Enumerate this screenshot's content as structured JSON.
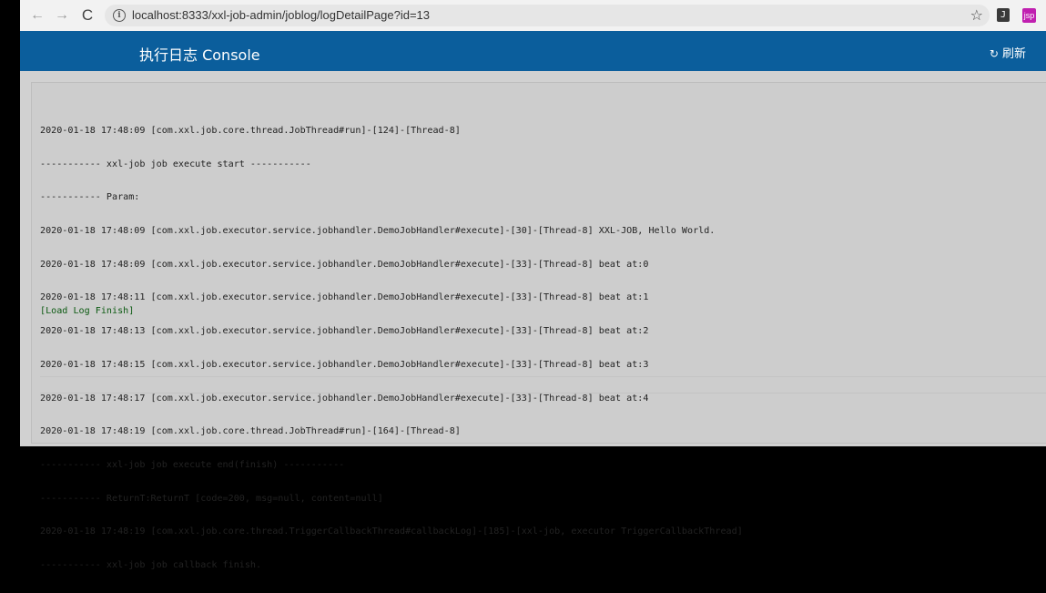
{
  "browser": {
    "url": "localhost:8333/xxl-job-admin/joblog/logDetailPage?id=13",
    "back_glyph": "←",
    "forward_glyph": "→",
    "reload_glyph": "C",
    "info_glyph": "i",
    "star_glyph": "☆",
    "ext_j_label": "J",
    "ext_p_label": "jsp"
  },
  "header": {
    "title": "执行日志 Console",
    "refresh_glyph": "↻",
    "refresh_label": "刷新",
    "background": "#0b5e9c"
  },
  "log": {
    "lines": [
      "2020-01-18 17:48:09 [com.xxl.job.core.thread.JobThread#run]-[124]-[Thread-8]",
      "----------- xxl-job job execute start -----------",
      "----------- Param:",
      "2020-01-18 17:48:09 [com.xxl.job.executor.service.jobhandler.DemoJobHandler#execute]-[30]-[Thread-8] XXL-JOB, Hello World.",
      "2020-01-18 17:48:09 [com.xxl.job.executor.service.jobhandler.DemoJobHandler#execute]-[33]-[Thread-8] beat at:0",
      "2020-01-18 17:48:11 [com.xxl.job.executor.service.jobhandler.DemoJobHandler#execute]-[33]-[Thread-8] beat at:1",
      "2020-01-18 17:48:13 [com.xxl.job.executor.service.jobhandler.DemoJobHandler#execute]-[33]-[Thread-8] beat at:2",
      "2020-01-18 17:48:15 [com.xxl.job.executor.service.jobhandler.DemoJobHandler#execute]-[33]-[Thread-8] beat at:3",
      "2020-01-18 17:48:17 [com.xxl.job.executor.service.jobhandler.DemoJobHandler#execute]-[33]-[Thread-8] beat at:4",
      "2020-01-18 17:48:19 [com.xxl.job.core.thread.JobThread#run]-[164]-[Thread-8]",
      "----------- xxl-job job execute end(finish) -----------",
      "----------- ReturnT:ReturnT [code=200, msg=null, content=null]",
      "2020-01-18 17:48:19 [com.xxl.job.core.thread.TriggerCallbackThread#callbackLog]-[185]-[xxl-job, executor TriggerCallbackThread]",
      "----------- xxl-job job callback finish."
    ],
    "finish_text": "[Load Log Finish]",
    "finish_color": "#0c5a12"
  }
}
